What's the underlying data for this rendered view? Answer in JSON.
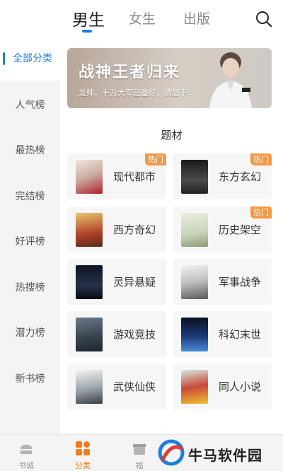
{
  "top_tabs": [
    {
      "label": "男生",
      "active": true
    },
    {
      "label": "女生",
      "active": false
    },
    {
      "label": "出版",
      "active": false
    }
  ],
  "sidebar": {
    "items": [
      {
        "label": "全部分类",
        "active": true
      },
      {
        "label": "人气榜"
      },
      {
        "label": "最热榜"
      },
      {
        "label": "完结榜"
      },
      {
        "label": "好评榜"
      },
      {
        "label": "热搜榜"
      },
      {
        "label": "潜力榜"
      },
      {
        "label": "新书榜"
      }
    ]
  },
  "banner": {
    "title": "战神王者归来",
    "subtitle": "龙帅，十万大军已备好，请您下..."
  },
  "section": {
    "title": "题材"
  },
  "categories": [
    {
      "label": "现代都市",
      "hot": "热门"
    },
    {
      "label": "东方玄幻",
      "hot": "热门"
    },
    {
      "label": "西方奇幻",
      "hot": ""
    },
    {
      "label": "历史架空",
      "hot": "热门"
    },
    {
      "label": "灵异悬疑",
      "hot": ""
    },
    {
      "label": "军事战争",
      "hot": ""
    },
    {
      "label": "游戏竞技",
      "hot": ""
    },
    {
      "label": "科幻末世",
      "hot": ""
    },
    {
      "label": "武侠仙侠",
      "hot": ""
    },
    {
      "label": "同人小说",
      "hot": ""
    }
  ],
  "bottom_nav": [
    {
      "label": "书城",
      "icon": "bookstore-icon",
      "active": false
    },
    {
      "label": "分类",
      "icon": "category-grid-icon",
      "active": true
    },
    {
      "label": "福",
      "icon": "gift-icon",
      "active": false
    }
  ],
  "watermark": {
    "text": "牛马软件园"
  },
  "colors": {
    "accent_blue": "#1a7fe0",
    "active_orange": "#f07d1d",
    "hot_badge": "#f39847"
  }
}
